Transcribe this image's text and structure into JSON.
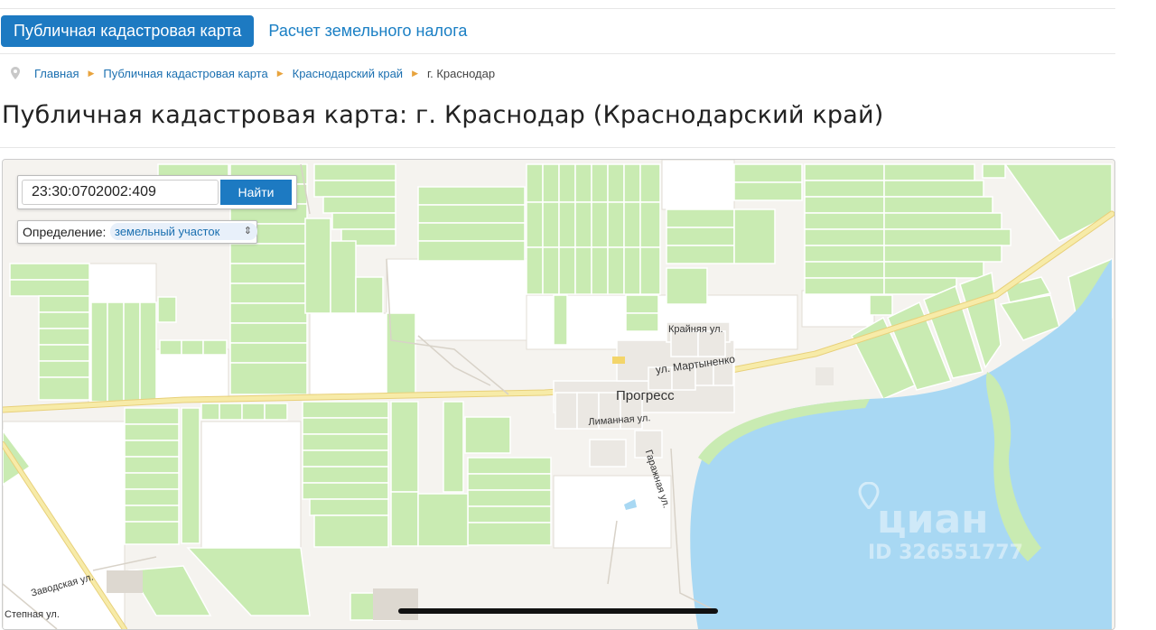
{
  "tabs": [
    {
      "label": "Публичная кадастровая карта",
      "active": true
    },
    {
      "label": "Расчет земельного налога",
      "active": false
    }
  ],
  "breadcrumbs": {
    "items": [
      "Главная",
      "Публичная кадастровая карта",
      "Краснодарский край"
    ],
    "current": "г. Краснодар"
  },
  "page_title": "Публичная кадастровая карта: г. Краснодар (Краснодарский край)",
  "search": {
    "value": "23:30:0702002:409",
    "button_label": "Найти"
  },
  "definition": {
    "label": "Определение:",
    "selected": "земельный участок"
  },
  "map": {
    "labels": {
      "krainyaya": "Крайняя ул.",
      "martynenko": "ул. Мартыненко",
      "progress": "Прогресс",
      "limannaya": "Лиманная ул.",
      "garazhnaya": "Гаражная ул.",
      "zavodskaya": "Заводская ул.",
      "stepnaya": "Степная ул."
    },
    "watermark": {
      "brand": "циан",
      "id": "ID 326551777"
    },
    "colors": {
      "field": "#c9ebb2",
      "water": "#a8d8f3",
      "road": "#f5e6a6",
      "background": "#f5f3ef",
      "accent": "#1d7ac2"
    }
  }
}
